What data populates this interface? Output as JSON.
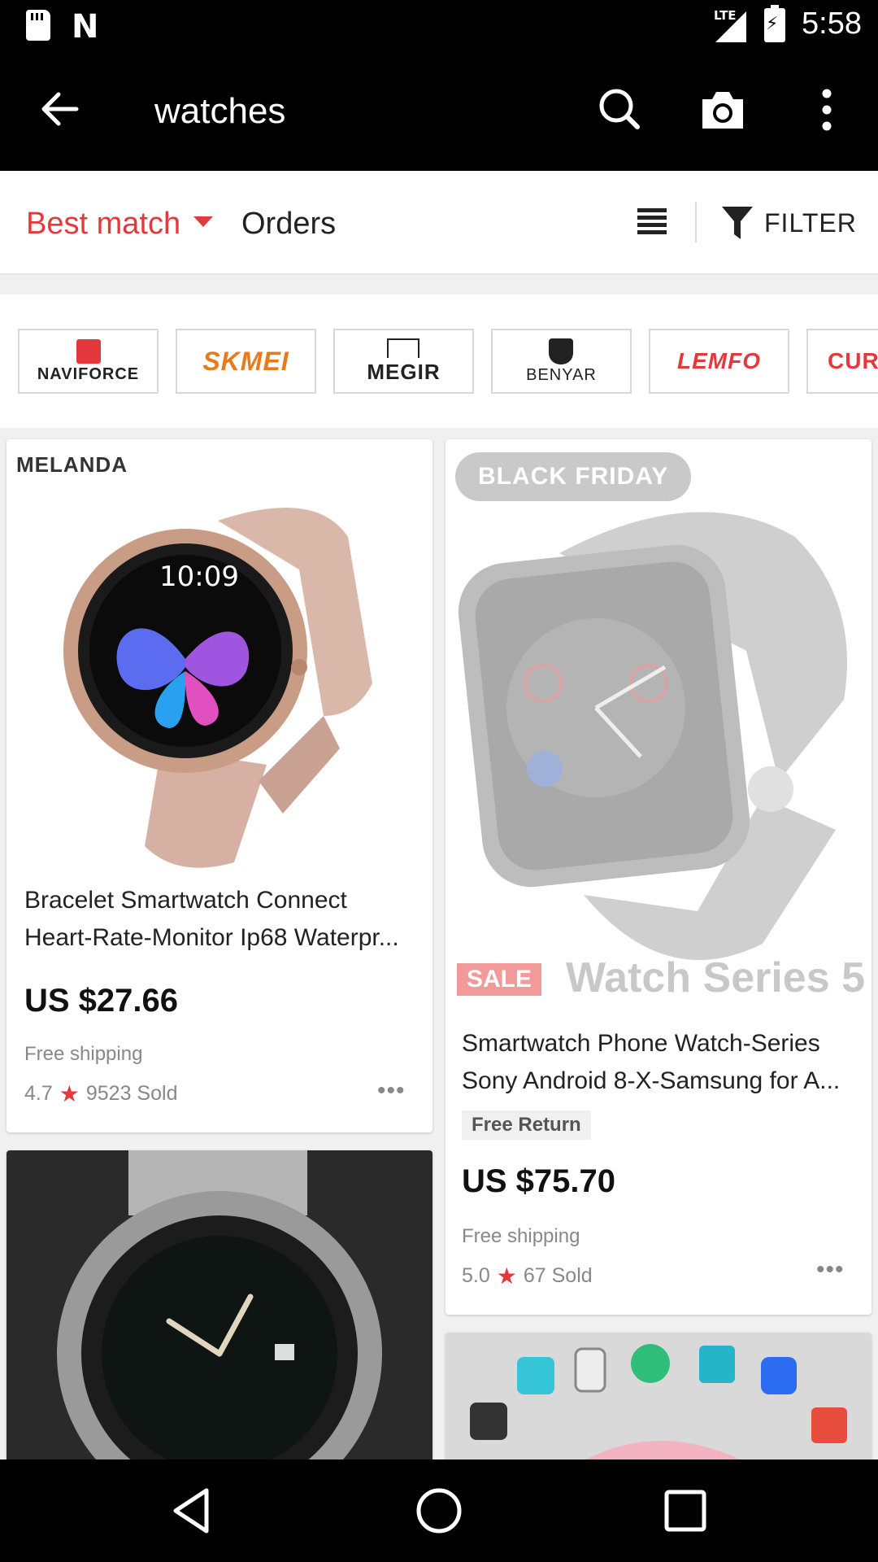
{
  "status_bar": {
    "network": "LTE",
    "time": "5:58",
    "notification_letter": "N"
  },
  "app_bar": {
    "title": "watches",
    "icons": [
      "back-arrow-icon",
      "search-icon",
      "camera-icon",
      "more-vert-icon"
    ]
  },
  "sort_bar": {
    "best_match": "Best match",
    "orders": "Orders",
    "filter": "FILTER",
    "accent_color": "#e4393c"
  },
  "brands": [
    {
      "name": "NAVIFORCE",
      "color": "#e4393c"
    },
    {
      "name": "SKMEI",
      "color": "#f0a020"
    },
    {
      "name": "MEGIR",
      "color": "#222222"
    },
    {
      "name": "BENYAR",
      "color": "#222222"
    },
    {
      "name": "LEMFO",
      "color": "#e4393c"
    },
    {
      "name": "CUR",
      "color": "#e4393c"
    }
  ],
  "products": [
    {
      "brand_label": "MELANDA",
      "title_line1": "Bracelet Smartwatch Connect",
      "title_line2": "Heart-Rate-Monitor Ip68 Waterpr...",
      "price": "US $27.66",
      "shipping": "Free shipping",
      "rating": "4.7",
      "sold": "9523 Sold"
    },
    {
      "promo_label": "BLACK FRIDAY",
      "sale_tag": "SALE",
      "banner_text": "Watch Series 5",
      "title_line1": "Smartwatch Phone Watch-Series",
      "title_line2": "Sony Android 8-X-Samsung for A...",
      "free_return": "Free Return",
      "price": "US $75.70",
      "shipping": "Free shipping",
      "rating": "5.0",
      "sold": "67 Sold"
    }
  ],
  "more_dots": "•••",
  "nav_bar": {
    "icons": [
      "back-triangle-icon",
      "home-circle-icon",
      "recents-square-icon"
    ]
  }
}
